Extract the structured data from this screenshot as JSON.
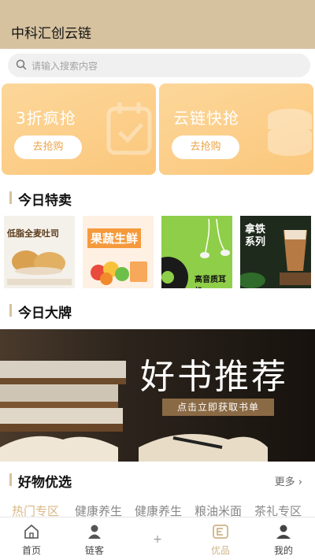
{
  "header": {
    "title": "中科汇创云链"
  },
  "search": {
    "placeholder": "请输入搜索内容"
  },
  "promos": [
    {
      "title": "3折疯抢",
      "button": "去抢购"
    },
    {
      "title": "云链快抢",
      "button": "去抢购"
    }
  ],
  "sections": {
    "today_sale": "今日特卖",
    "today_brand": "今日大牌",
    "good_picks": "好物优选",
    "more": "更多"
  },
  "products": [
    {
      "label": "低脂全麦吐司"
    },
    {
      "label": "果蔬生鲜"
    },
    {
      "label": "高音质耳机"
    },
    {
      "label": "拿铁系列"
    }
  ],
  "banner": {
    "title": "好书推荐",
    "subtitle": "点击立即获取书单"
  },
  "categories": [
    "热门专区",
    "健康养生",
    "健康养生",
    "粮油米面",
    "茶礼专区"
  ],
  "tabbar": {
    "items": [
      {
        "label": "首页",
        "icon": "home-icon"
      },
      {
        "label": "链客",
        "icon": "person-icon"
      },
      {
        "label": "+",
        "icon": "plus-icon"
      },
      {
        "label": "优品",
        "icon": "shop-icon"
      },
      {
        "label": "我的",
        "icon": "profile-icon"
      }
    ]
  },
  "colors": {
    "accent": "#d6c29f",
    "promo": "#fbc77c",
    "active_tab": "#cfb489"
  }
}
